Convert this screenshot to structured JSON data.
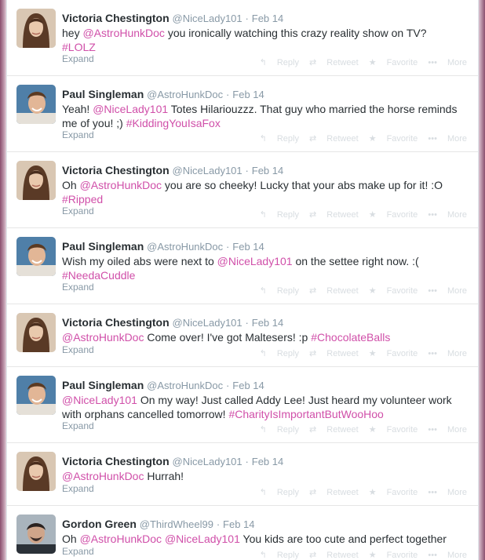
{
  "actions": {
    "reply": "Reply",
    "retweet": "Retweet",
    "favorite": "Favorite",
    "more": "More",
    "expand": "Expand"
  },
  "tweets": [
    {
      "avatar": "victoria",
      "name": "Victoria Chestington",
      "handle": "@NiceLady101",
      "date": "Feb 14",
      "parts": [
        {
          "t": "hey "
        },
        {
          "t": "@AstroHunkDoc",
          "hl": true
        },
        {
          "t": " you ironically watching this crazy reality show on TV? "
        },
        {
          "t": "#LOLZ",
          "hl": true
        }
      ]
    },
    {
      "avatar": "paul",
      "name": "Paul Singleman",
      "handle": "@AstroHunkDoc",
      "date": "Feb 14",
      "parts": [
        {
          "t": "Yeah! "
        },
        {
          "t": "@NiceLady101",
          "hl": true
        },
        {
          "t": " Totes Hilariouzzz. That guy who married the horse reminds me of you! ;) "
        },
        {
          "t": "#KiddingYouIsaFox",
          "hl": true
        }
      ]
    },
    {
      "avatar": "victoria",
      "name": "Victoria Chestington",
      "handle": "@NiceLady101",
      "date": "Feb 14",
      "parts": [
        {
          "t": "Oh "
        },
        {
          "t": "@AstroHunkDoc",
          "hl": true
        },
        {
          "t": " you are so cheeky! Lucky that your abs make up for it! :O "
        },
        {
          "t": "#Ripped",
          "hl": true
        }
      ]
    },
    {
      "avatar": "paul",
      "name": "Paul Singleman",
      "handle": "@AstroHunkDoc",
      "date": "Feb 14",
      "parts": [
        {
          "t": "Wish my oiled abs were next to "
        },
        {
          "t": "@NiceLady101",
          "hl": true
        },
        {
          "t": " on the settee right now. :( "
        },
        {
          "t": "#NeedaCuddle",
          "hl": true
        }
      ]
    },
    {
      "avatar": "victoria",
      "name": "Victoria Chestington",
      "handle": "@NiceLady101",
      "date": "Feb 14",
      "short": true,
      "parts": [
        {
          "t": "@AstroHunkDoc",
          "hl": true
        },
        {
          "t": " Come over! I've got Maltesers! :p "
        },
        {
          "t": "#ChocolateBalls",
          "hl": true
        }
      ]
    },
    {
      "avatar": "paul",
      "name": "Paul Singleman",
      "handle": "@AstroHunkDoc",
      "date": "Feb 14",
      "parts": [
        {
          "t": "@NiceLady101",
          "hl": true
        },
        {
          "t": " On my way! Just called Addy Lee! Just heard my volunteer work with orphans cancelled tomorrow! "
        },
        {
          "t": "#CharityIsImportantButWooHoo",
          "hl": true
        }
      ]
    },
    {
      "avatar": "victoria",
      "name": "Victoria Chestington",
      "handle": "@NiceLady101",
      "date": "Feb 14",
      "short": true,
      "parts": [
        {
          "t": "@AstroHunkDoc",
          "hl": true
        },
        {
          "t": " Hurrah!"
        }
      ]
    },
    {
      "avatar": "gordon",
      "name": "Gordon Green",
      "handle": "@ThirdWheel99",
      "date": "Feb 14",
      "short": true,
      "parts": [
        {
          "t": "Oh "
        },
        {
          "t": "@AstroHunkDoc",
          "hl": true
        },
        {
          "t": " "
        },
        {
          "t": "@NiceLady101",
          "hl": true
        },
        {
          "t": " You kids are too cute and perfect together"
        }
      ]
    }
  ]
}
